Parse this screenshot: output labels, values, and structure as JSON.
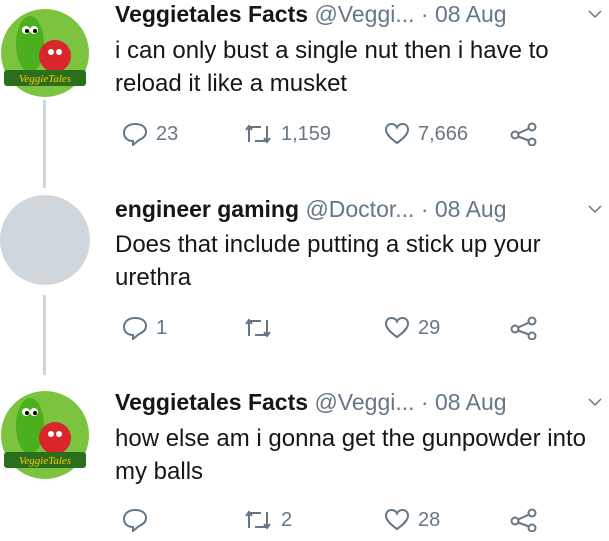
{
  "tweets": [
    {
      "name": "Veggietales Facts",
      "handle": "@Veggi...",
      "date": "· 08 Aug",
      "text": "i can only bust a single nut then i have to reload it like a musket",
      "replies": "23",
      "retweets": "1,159",
      "likes": "7,666",
      "avatar_text": "VeggieTales"
    },
    {
      "name": "engineer gaming",
      "handle": "@Doctor...",
      "date": "· 08 Aug",
      "text": "Does that include putting a stick up your urethra",
      "replies": "1",
      "retweets": "",
      "likes": "29"
    },
    {
      "name": "Veggietales Facts",
      "handle": "@Veggi...",
      "date": "· 08 Aug",
      "text": "how else am i gonna get the gunpowder into my balls",
      "replies": "",
      "retweets": "2",
      "likes": "28",
      "avatar_text": "VeggieTales"
    }
  ],
  "colors": {
    "muted": "#657786",
    "line": "#cfd7dd",
    "bob_green": "#2e8b2e",
    "larry": "#4caf1e"
  }
}
